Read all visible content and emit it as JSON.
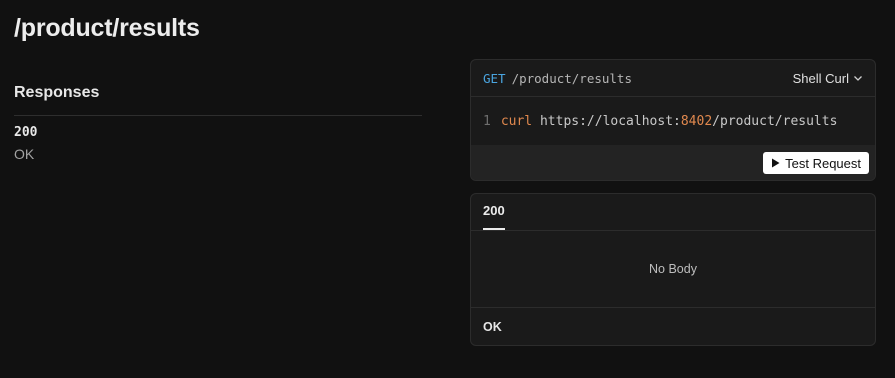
{
  "page": {
    "title": "/product/results"
  },
  "responses": {
    "heading": "Responses",
    "items": [
      {
        "code": "200",
        "description": "OK"
      }
    ]
  },
  "request": {
    "method": "GET",
    "path": "/product/results",
    "client": "Shell Curl",
    "code": {
      "line_number": "1",
      "command": "curl",
      "url_before_port": "https://localhost:",
      "port": "8402",
      "url_after_port": "/product/results"
    },
    "test_button": "Test Request"
  },
  "response_panel": {
    "tab": "200",
    "body": "No Body",
    "status_text": "OK"
  },
  "colors": {
    "background": "#111111",
    "method": "#4aa5e0",
    "keyword": "#e0884e"
  },
  "icons": {
    "client_dropdown": "chevron-down-icon",
    "test_button": "play-icon"
  }
}
